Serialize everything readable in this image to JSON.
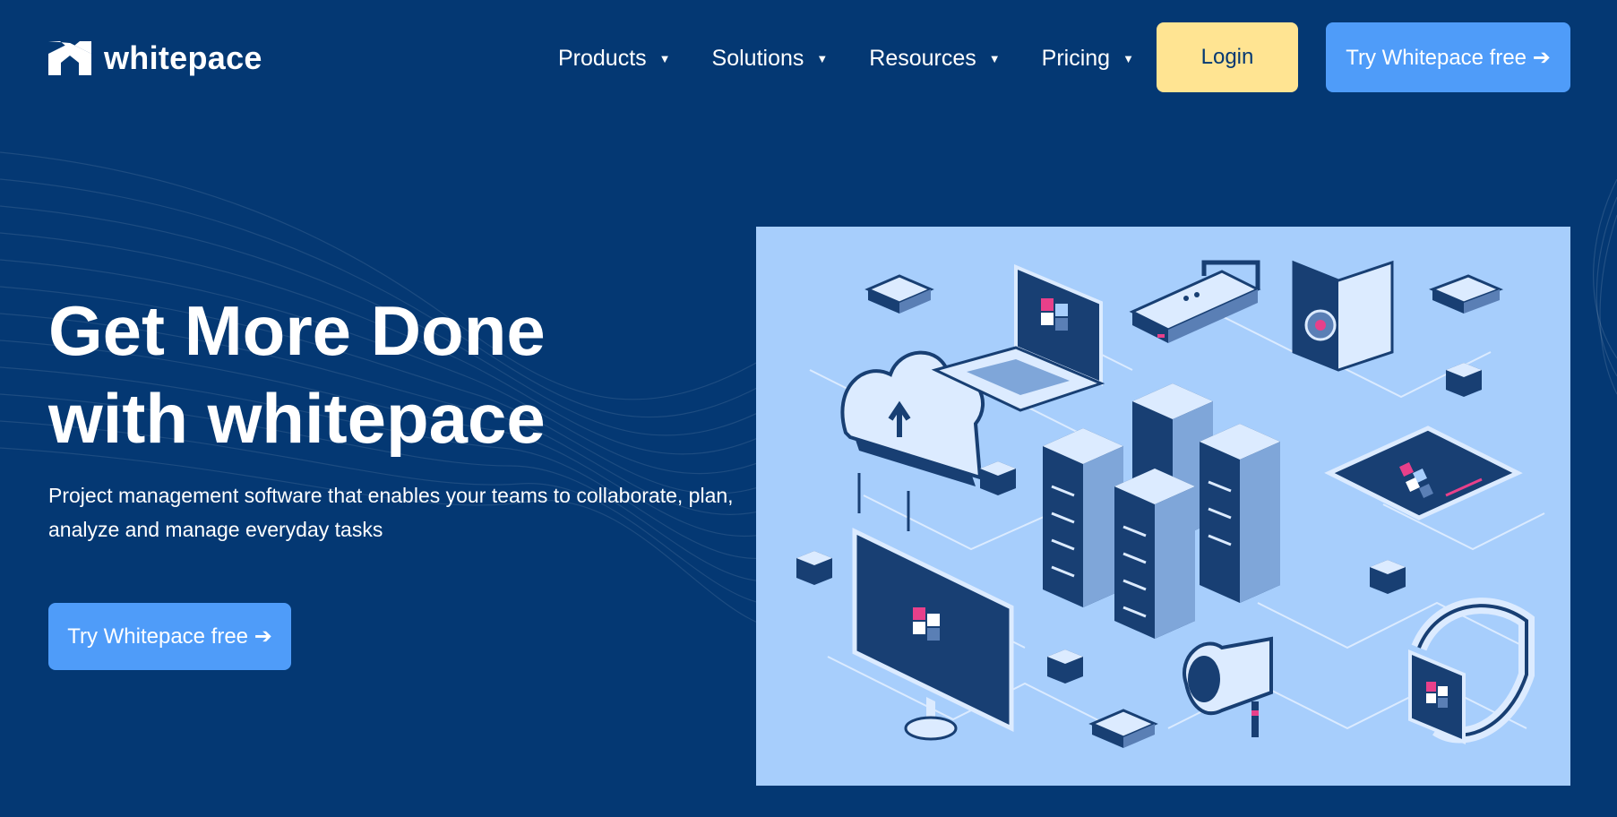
{
  "brand": {
    "name": "whitepace",
    "logo_icon": "whitepace-logo-icon"
  },
  "nav": {
    "items": [
      {
        "label": "Products",
        "icon": "caret-down-icon"
      },
      {
        "label": "Solutions",
        "icon": "caret-down-icon"
      },
      {
        "label": "Resources",
        "icon": "caret-down-icon"
      },
      {
        "label": "Pricing",
        "icon": "caret-down-icon"
      }
    ],
    "login_label": "Login",
    "cta_label": "Try Whitepace free ➔"
  },
  "hero": {
    "title_line1": "Get More Done",
    "title_line2": "with whitepace",
    "subtitle": "Project management software that enables your teams to collaborate, plan, analyze and manage everyday tasks",
    "cta_label": "Try Whitepace free ➔"
  },
  "colors": {
    "background": "#043873",
    "accent_blue": "#4F9CF9",
    "accent_yellow": "#FFE492",
    "illustration_bg": "#A7CEFC",
    "highlight_pink": "#E8408A"
  }
}
